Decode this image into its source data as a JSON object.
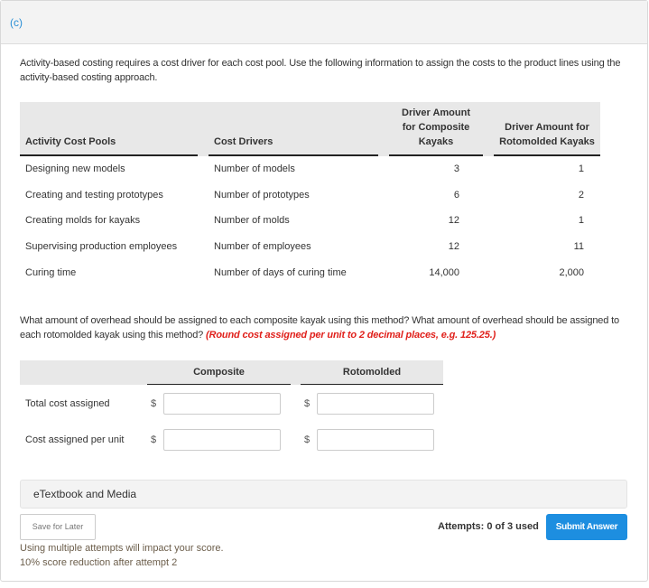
{
  "part": {
    "label": "(c)"
  },
  "intro": "Activity-based costing requires a cost driver for each cost pool. Use the following information to assign the costs to the product lines using the activity-based costing approach.",
  "drivers_table": {
    "headers": {
      "pool": "Activity Cost Pools",
      "driver": "Cost Drivers",
      "composite": "Driver Amount for Composite Kayaks",
      "rotomolded": "Driver Amount for Rotomolded Kayaks"
    },
    "rows": [
      {
        "pool": "Designing new models",
        "driver": "Number of models",
        "composite": "3",
        "rotomolded": "1"
      },
      {
        "pool": "Creating and testing prototypes",
        "driver": "Number of prototypes",
        "composite": "6",
        "rotomolded": "2"
      },
      {
        "pool": "Creating molds for kayaks",
        "driver": "Number of molds",
        "composite": "12",
        "rotomolded": "1"
      },
      {
        "pool": "Supervising production employees",
        "driver": "Number of employees",
        "composite": "12",
        "rotomolded": "11"
      },
      {
        "pool": "Curing time",
        "driver": "Number of days of curing time",
        "composite": "14,000",
        "rotomolded": "2,000"
      }
    ]
  },
  "question": {
    "text": "What amount of overhead should be assigned to each composite kayak using this method? What amount of overhead should be assigned to each rotomolded kayak using this method? ",
    "hint": "(Round cost assigned per unit to 2 decimal places, e.g. 125.25.)"
  },
  "answer_table": {
    "headers": {
      "composite": "Composite",
      "rotomolded": "Rotomolded"
    },
    "currency_symbol": "$",
    "rows": [
      {
        "label": "Total cost assigned",
        "composite_value": "",
        "rotomolded_value": ""
      },
      {
        "label": "Cost assigned per unit",
        "composite_value": "",
        "rotomolded_value": ""
      }
    ]
  },
  "etextbook": {
    "label": "eTextbook and Media"
  },
  "footer": {
    "save_label": "Save for Later",
    "attempts": "Attempts: 0 of 3 used",
    "submit_label": "Submit Answer",
    "notice_line1": "Using multiple attempts will impact your score.",
    "notice_line2": "10% score reduction after attempt 2"
  }
}
